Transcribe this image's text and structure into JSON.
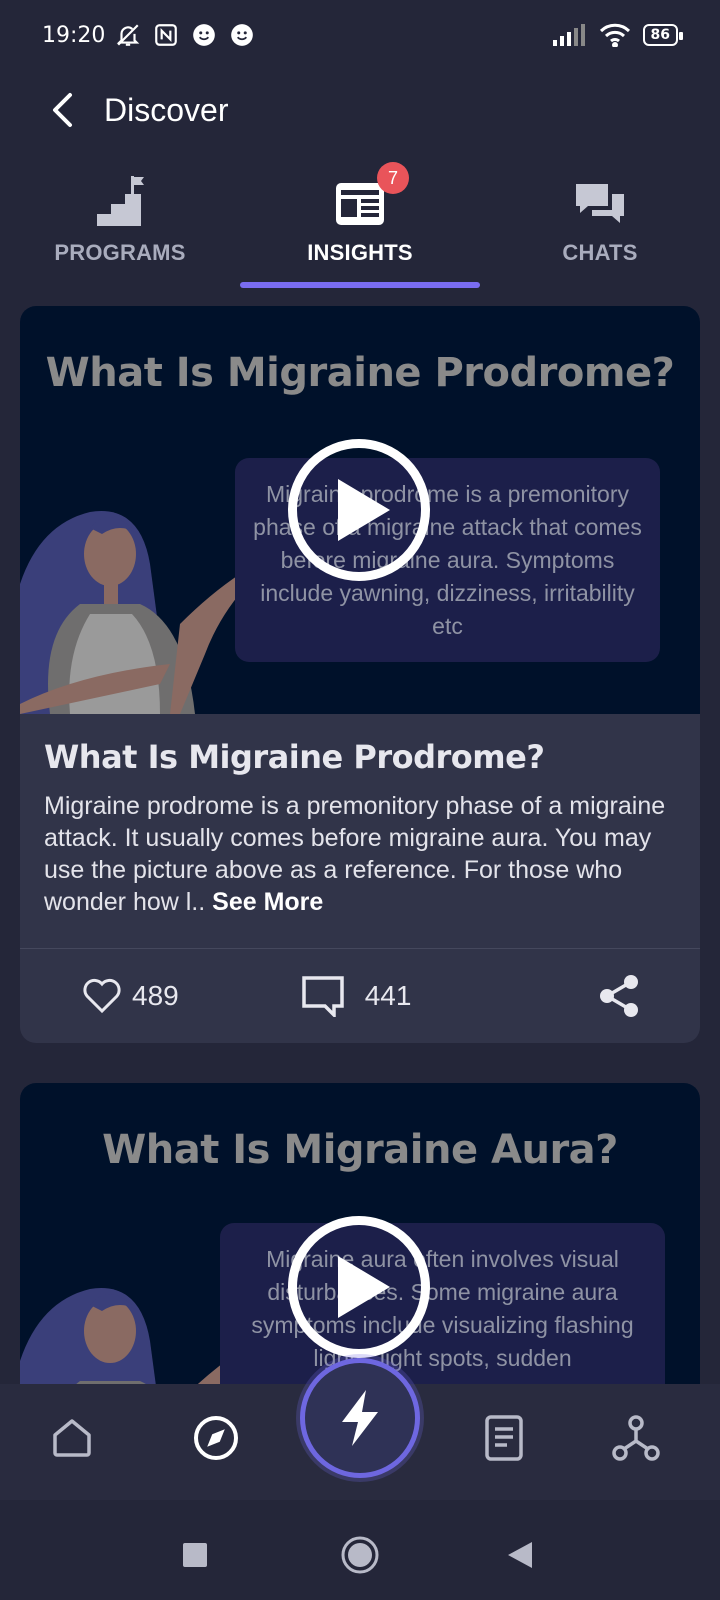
{
  "status_bar": {
    "time": "19:20",
    "battery": "86",
    "icons_left": [
      "bell-off-icon",
      "nfc-icon",
      "smiley-icon",
      "smiley-icon"
    ],
    "icons_right": [
      "signal-icon",
      "wifi-icon",
      "battery-icon"
    ]
  },
  "header": {
    "title": "Discover",
    "back_icon": "chevron-left-icon"
  },
  "tabs": [
    {
      "label": "PROGRAMS",
      "icon": "stairs-flag-icon",
      "active": false
    },
    {
      "label": "INSIGHTS",
      "icon": "newspaper-icon",
      "active": true,
      "badge": "7"
    },
    {
      "label": "CHATS",
      "icon": "chat-bubbles-icon",
      "active": false
    }
  ],
  "colors": {
    "background": "#242639",
    "card": "#313449",
    "accent": "#7a6cf0",
    "badge": "#e9545a",
    "media_bg": "#00112a"
  },
  "cards": [
    {
      "media_title": "What Is Migraine Prodrome?",
      "media_text": "Migraine prodrome is a premonitory phase of a migraine attack that comes before migraine aura. Symptoms include yawning, dizziness, irritability etc",
      "title": "What Is Migraine Prodrome?",
      "description": "Migraine prodrome is a premonitory phase of a migraine attack. It usually comes before migraine aura. You may use the picture above as a reference. For those who wonder how l.. ",
      "see_more": "See More",
      "likes": "489",
      "comments": "441"
    },
    {
      "media_title": "What Is Migraine Aura?",
      "media_text": "Migraine aura often involves visual disturbances. Some migraine aura symptoms include visualizing flashing lights, light spots, sudden"
    }
  ],
  "bottom_nav": {
    "items": [
      "home-icon",
      "compass-icon",
      "lightning-icon",
      "journal-icon",
      "network-icon"
    ],
    "active": "compass-icon"
  },
  "system_nav": [
    "square-icon",
    "circle-icon",
    "triangle-back-icon"
  ]
}
